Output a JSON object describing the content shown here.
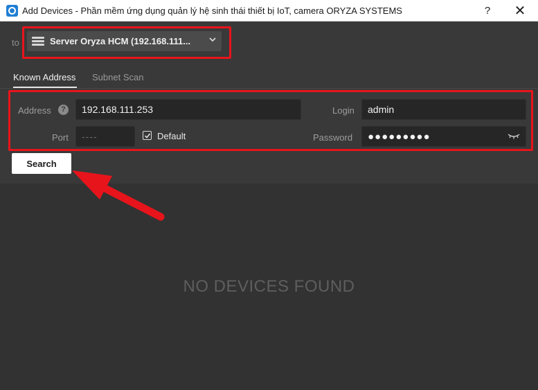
{
  "window": {
    "title": "Add Devices - Phần mềm ứng dụng quản lý hệ sinh thái thiết bị IoT, camera ORYZA SYSTEMS",
    "help_label": "?",
    "close_label": "✕",
    "icon": "app-logo-icon"
  },
  "target": {
    "to_label": "to",
    "server_label": "Server Oryza HCM (192.168.111...",
    "server_icon": "server-icon",
    "chevron_icon": "chevron-down-icon"
  },
  "tabs": [
    {
      "label": "Known Address",
      "active": true
    },
    {
      "label": "Subnet Scan",
      "active": false
    }
  ],
  "form": {
    "address_label": "Address",
    "address_value": "192.168.111.253",
    "help_icon_label": "?",
    "port_label": "Port",
    "port_placeholder": "----",
    "default_label": "Default",
    "default_checked": true,
    "login_label": "Login",
    "login_value": "admin",
    "password_label": "Password",
    "password_value": "●●●●●●●●●",
    "password_visibility_icon": "eye-hidden-icon"
  },
  "actions": {
    "search_label": "Search"
  },
  "results": {
    "empty_message": "NO DEVICES FOUND"
  },
  "colors": {
    "annotation_red": "#e8141b",
    "background": "#323232",
    "panel": "#393939"
  }
}
